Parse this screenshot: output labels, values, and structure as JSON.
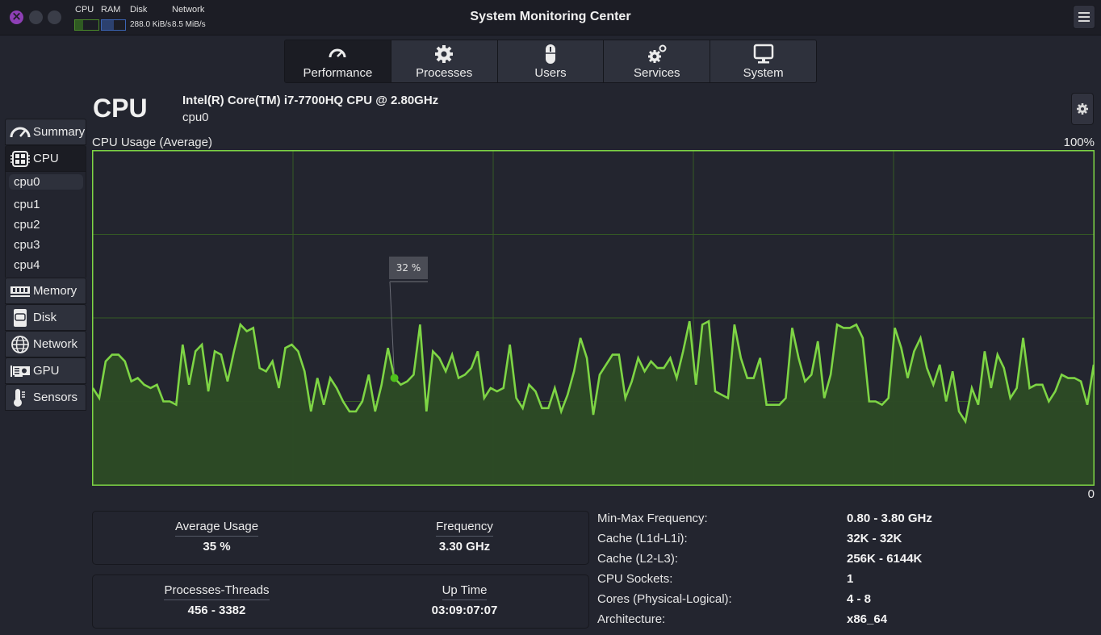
{
  "window": {
    "title": "System Monitoring Center",
    "mini_monitors": {
      "cpu_label": "CPU",
      "ram_label": "RAM",
      "disk_label": "Disk",
      "network_label": "Network",
      "cpu_fraction": 0.35,
      "ram_fraction": 0.5,
      "disk_value": "288.0 KiB/s",
      "network_value": "8.5 MiB/s"
    }
  },
  "tabs": [
    {
      "label": "Performance",
      "icon": "gauge-icon",
      "active": true
    },
    {
      "label": "Processes",
      "icon": "gear-icon",
      "active": false
    },
    {
      "label": "Users",
      "icon": "mouse-icon",
      "active": false
    },
    {
      "label": "Services",
      "icon": "gears-icon",
      "active": false
    },
    {
      "label": "System",
      "icon": "monitor-icon",
      "active": false
    }
  ],
  "sidebar": {
    "items": [
      {
        "label": "Summary",
        "icon": "gauge-icon"
      },
      {
        "label": "CPU",
        "icon": "cpu-chip-icon"
      },
      {
        "label": "Memory",
        "icon": "ram-icon"
      },
      {
        "label": "Disk",
        "icon": "disk-icon"
      },
      {
        "label": "Network",
        "icon": "globe-icon"
      },
      {
        "label": "GPU",
        "icon": "gpu-icon"
      },
      {
        "label": "Sensors",
        "icon": "thermometer-icon"
      }
    ],
    "cpu_subitems": [
      "cpu0",
      "cpu1",
      "cpu2",
      "cpu3",
      "cpu4"
    ],
    "selected_subitem": "cpu0"
  },
  "header": {
    "title": "CPU",
    "model": "Intel(R) Core(TM) i7-7700HQ CPU @ 2.80GHz",
    "selected_core": "cpu0"
  },
  "chart_data": {
    "type": "area",
    "title": "CPU Usage (Average)",
    "ymax_label": "100%",
    "ymin_label": "0",
    "ylim": [
      0,
      100
    ],
    "grid": true,
    "grid_rows": 4,
    "grid_cols": 5,
    "line_color": "#7ed545",
    "fill_color": "#2d4b25",
    "grid_color": "#355a25",
    "tooltip": {
      "label": "32 %",
      "index": 47
    },
    "values": [
      29,
      26,
      37,
      39,
      39,
      37,
      31,
      32,
      30,
      29,
      30,
      25,
      25,
      24,
      42,
      30,
      40,
      42,
      28,
      40,
      39,
      31,
      40,
      48,
      46,
      47,
      35,
      34,
      37,
      29,
      41,
      42,
      40,
      34,
      22,
      32,
      24,
      32,
      29,
      25,
      22,
      22,
      25,
      33,
      22,
      30,
      41,
      32,
      30,
      31,
      33,
      48,
      22,
      40,
      38,
      34,
      39,
      32,
      33,
      35,
      40,
      26,
      29,
      28,
      29,
      42,
      26,
      23,
      30,
      28,
      23,
      23,
      29,
      22,
      27,
      34,
      44,
      38,
      21,
      33,
      36,
      39,
      39,
      26,
      31,
      38,
      34,
      37,
      35,
      35,
      38,
      32,
      40,
      49,
      30,
      48,
      49,
      28,
      27,
      26,
      48,
      38,
      32,
      32,
      38,
      24,
      24,
      24,
      26,
      47,
      38,
      31,
      33,
      43,
      26,
      33,
      48,
      47,
      47,
      48,
      44,
      25,
      25,
      24,
      26,
      47,
      41,
      32,
      40,
      44,
      35,
      30,
      36,
      25,
      34,
      22,
      19,
      29,
      24,
      40,
      29,
      39,
      35,
      26,
      29,
      44,
      29,
      30,
      30,
      25,
      28,
      33,
      32,
      32,
      31,
      24,
      36
    ]
  },
  "cards": [
    [
      {
        "label": "Average Usage",
        "value": "35 %"
      },
      {
        "label": "Frequency",
        "value": "3.30 GHz"
      }
    ],
    [
      {
        "label": "Processes-Threads",
        "value": "456 - 3382"
      },
      {
        "label": "Up Time",
        "value": "03:09:07:07"
      }
    ]
  ],
  "details": [
    {
      "key": "Min-Max Frequency:",
      "value": "0.80 - 3.80 GHz"
    },
    {
      "key": "Cache (L1d-L1i):",
      "value": "32K - 32K"
    },
    {
      "key": "Cache (L2-L3):",
      "value": "256K - 6144K"
    },
    {
      "key": "CPU Sockets:",
      "value": "1"
    },
    {
      "key": "Cores (Physical-Logical):",
      "value": "4 - 8"
    },
    {
      "key": "Architecture:",
      "value": "x86_64"
    }
  ]
}
